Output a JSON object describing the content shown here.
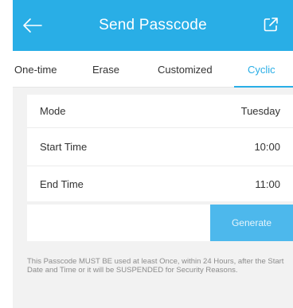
{
  "header": {
    "title": "Send Passcode",
    "back_icon": "arrow-left-icon",
    "share_icon": "share-icon"
  },
  "tabs": [
    {
      "label": "One-time",
      "active": false
    },
    {
      "label": "Erase",
      "active": false
    },
    {
      "label": "Customized",
      "active": false
    },
    {
      "label": "Cyclic",
      "active": true
    }
  ],
  "settings": {
    "mode": {
      "label": "Mode",
      "value": "Tuesday"
    },
    "start_time": {
      "label": "Start Time",
      "value": "10:00"
    },
    "end_time": {
      "label": "End Time",
      "value": "11:00"
    }
  },
  "generate": {
    "output_value": "",
    "button_label": "Generate"
  },
  "note": "This Passcode MUST BE used at least Once, within 24 Hours, after the Start Date and Time or it will be SUSPENDED for Security Reasons.",
  "colors": {
    "accent": "#29aee6",
    "button": "#4db8ec",
    "background": "#f2f2f2"
  }
}
